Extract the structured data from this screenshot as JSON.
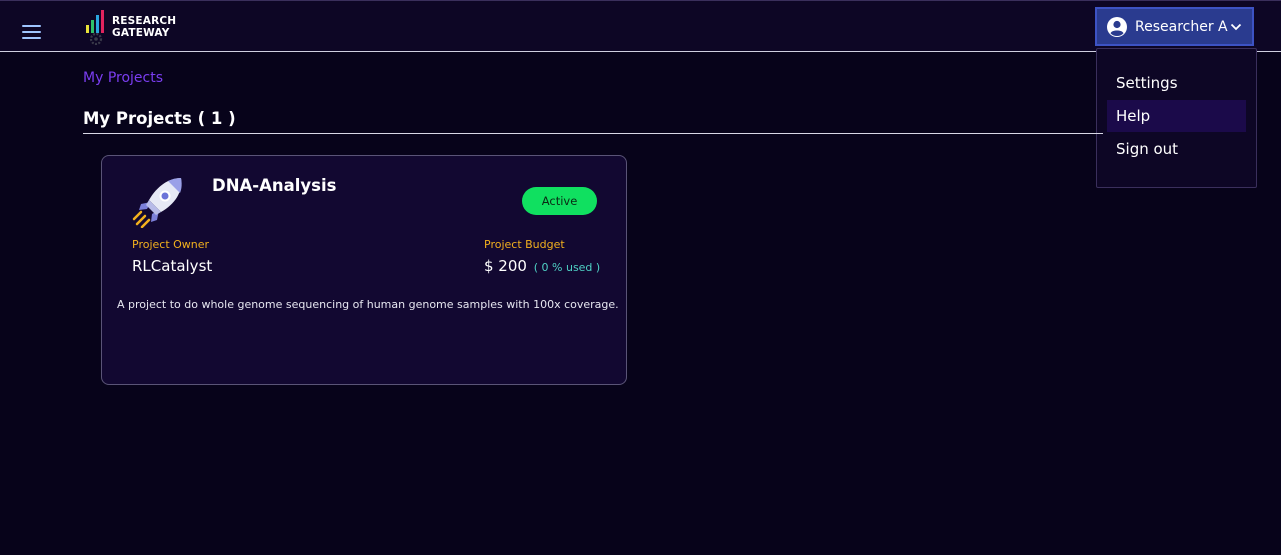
{
  "header": {
    "logo_text_line1": "RESEARCH",
    "logo_text_line2": "GATEWAY",
    "user_name": "Researcher A"
  },
  "user_menu": {
    "items": [
      "Settings",
      "Help",
      "Sign out"
    ],
    "highlighted_item": "Help"
  },
  "breadcrumb": {
    "current": "My Projects"
  },
  "section": {
    "title": "My Projects ( 1 )"
  },
  "projects": [
    {
      "name": "DNA-Analysis",
      "status": "Active",
      "owner_label": "Project Owner",
      "owner": "RLCatalyst",
      "budget_label": "Project Budget",
      "budget": "$ 200",
      "budget_used": "( 0 % used )",
      "description": "A project to do whole genome sequencing of human genome samples with 100x coverage.",
      "icon": "rocket-icon"
    }
  ],
  "colors": {
    "background": "#07031a",
    "header_bg": "#0d0625",
    "accent_purple": "#7a3df0",
    "user_button_bg": "#2a3b8f",
    "status_active": "#10e060",
    "label_gold": "#f2b01e",
    "budget_used_teal": "#4fd1c5"
  }
}
